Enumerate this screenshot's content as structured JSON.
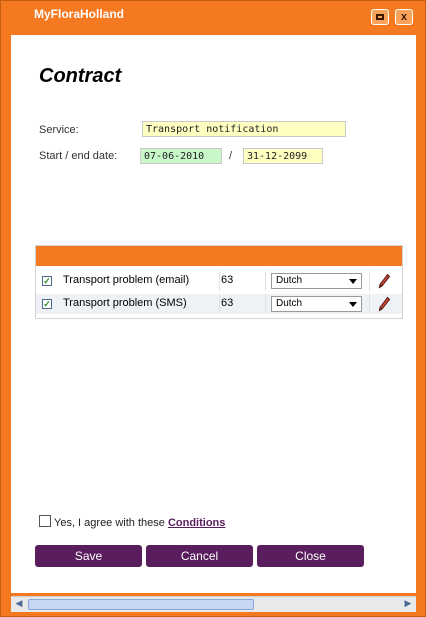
{
  "window": {
    "title": "MyFloraHolland",
    "restore_icon": "restore-icon",
    "close_icon": "close-icon",
    "close_glyph": "x",
    "accent_color": "#f47920",
    "button_color": "#5a1e5e"
  },
  "form": {
    "heading": "Contract",
    "service_label": "Service:",
    "service_value": "Transport notification",
    "dates_label": "Start / end date:",
    "start_date": "07-06-2010",
    "separator": "/",
    "end_date": "31-12-2099"
  },
  "grid": {
    "rows": [
      {
        "checked": true,
        "name": "Transport problem (email)",
        "number": "63",
        "language": "Dutch",
        "edit_icon": "pencil-icon"
      },
      {
        "checked": true,
        "name": "Transport problem (SMS)",
        "number": "63",
        "language": "Dutch",
        "edit_icon": "pencil-icon"
      }
    ]
  },
  "agreement": {
    "text": "Yes, I agree with these",
    "link": "Conditions"
  },
  "buttons": {
    "save": "Save",
    "cancel": "Cancel",
    "close": "Close"
  },
  "scrollbar": {
    "left_arrow": "◀",
    "right_arrow": "▶"
  }
}
